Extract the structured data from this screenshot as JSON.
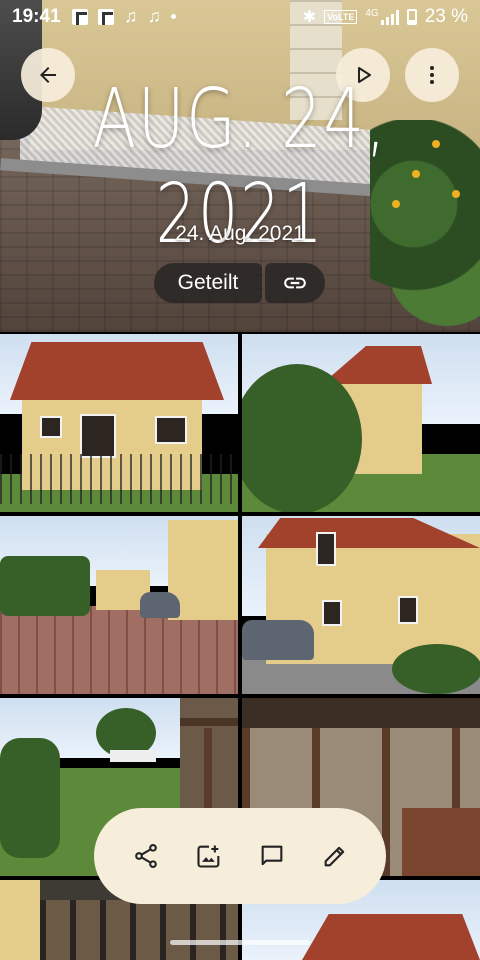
{
  "statusbar": {
    "time": "19:41",
    "network": "VoLTE",
    "signal_label": "4G",
    "battery": "23 %"
  },
  "header": {
    "title": "AUG. 24, 2021",
    "subtitle": "24. Aug. 2021",
    "shared_label": "Geteilt"
  },
  "icons": {
    "back": "arrow-left-icon",
    "play": "play-icon",
    "more": "more-vert-icon",
    "link": "link-icon",
    "share": "share-icon",
    "add_to_album": "add-photo-icon",
    "comment": "comment-icon",
    "edit": "edit-icon"
  },
  "colors": {
    "pill_bg": "#f6eedb",
    "shared_pill_bg": "#282624"
  }
}
